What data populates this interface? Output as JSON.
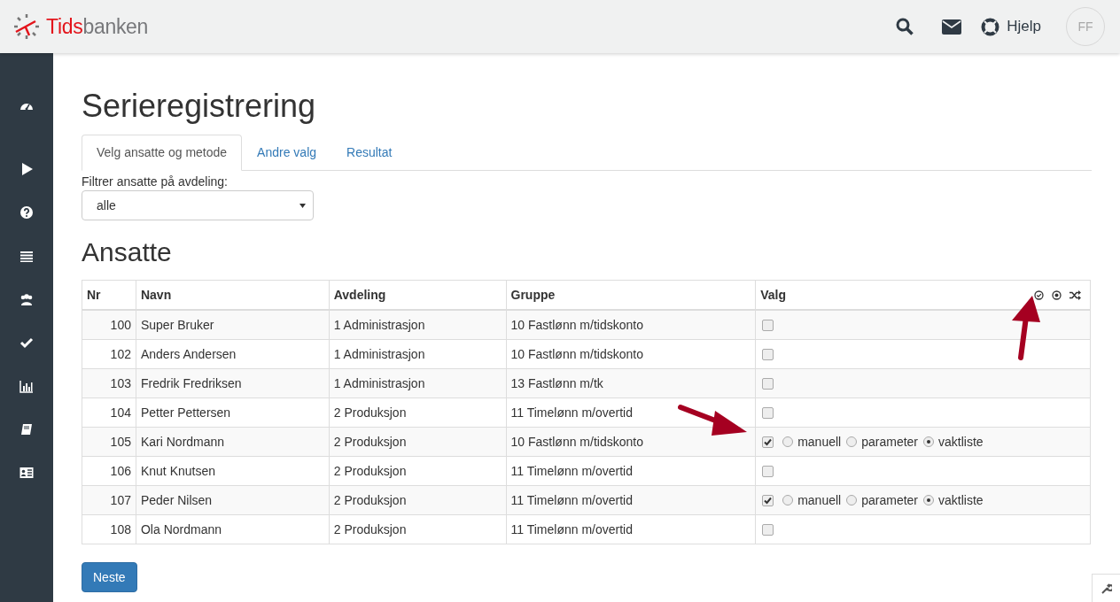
{
  "header": {
    "logo_parts": [
      {
        "text": "Tids",
        "accent": true
      },
      {
        "text": "banken",
        "accent": false
      }
    ],
    "help_label": "Hjelp",
    "avatar_initials": "FF"
  },
  "title": "Serieregistrering",
  "tabs": [
    {
      "label": "Velg ansatte og metode",
      "selected": true
    },
    {
      "label": "Andre valg",
      "selected": false
    },
    {
      "label": "Resultat",
      "selected": false
    }
  ],
  "filter": {
    "label": "Filtrer ansatte på avdeling:",
    "value": "alle"
  },
  "section_title": "Ansatte",
  "table": {
    "columns": [
      "Nr",
      "Navn",
      "Avdeling",
      "Gruppe",
      "Valg"
    ],
    "rows": [
      {
        "nr": "100",
        "navn": "Super Bruker",
        "avdeling": "1 Administrasjon",
        "gruppe": "10 Fastlønn m/tidskonto",
        "checked": false,
        "methods": []
      },
      {
        "nr": "102",
        "navn": "Anders Andersen",
        "avdeling": "1 Administrasjon",
        "gruppe": "10 Fastlønn m/tidskonto",
        "checked": false,
        "methods": []
      },
      {
        "nr": "103",
        "navn": "Fredrik Fredriksen",
        "avdeling": "1 Administrasjon",
        "gruppe": "13 Fastlønn m/tk",
        "checked": false,
        "methods": []
      },
      {
        "nr": "104",
        "navn": "Petter Pettersen",
        "avdeling": "2 Produksjon",
        "gruppe": "11 Timelønn m/overtid",
        "checked": false,
        "methods": []
      },
      {
        "nr": "105",
        "navn": "Kari Nordmann",
        "avdeling": "2 Produksjon",
        "gruppe": "10 Fastlønn m/tidskonto",
        "checked": true,
        "methods": [
          {
            "label": "manuell",
            "selected": false
          },
          {
            "label": "parameter",
            "selected": false
          },
          {
            "label": "vaktliste",
            "selected": true
          }
        ]
      },
      {
        "nr": "106",
        "navn": "Knut Knutsen",
        "avdeling": "2 Produksjon",
        "gruppe": "11 Timelønn m/overtid",
        "checked": false,
        "methods": []
      },
      {
        "nr": "107",
        "navn": "Peder Nilsen",
        "avdeling": "2 Produksjon",
        "gruppe": "11 Timelønn m/overtid",
        "checked": true,
        "methods": [
          {
            "label": "manuell",
            "selected": false
          },
          {
            "label": "parameter",
            "selected": false
          },
          {
            "label": "vaktliste",
            "selected": true
          }
        ]
      },
      {
        "nr": "108",
        "navn": "Ola Nordmann",
        "avdeling": "2 Produksjon",
        "gruppe": "11 Timelønn m/overtid",
        "checked": false,
        "methods": []
      }
    ]
  },
  "next_button": "Neste"
}
